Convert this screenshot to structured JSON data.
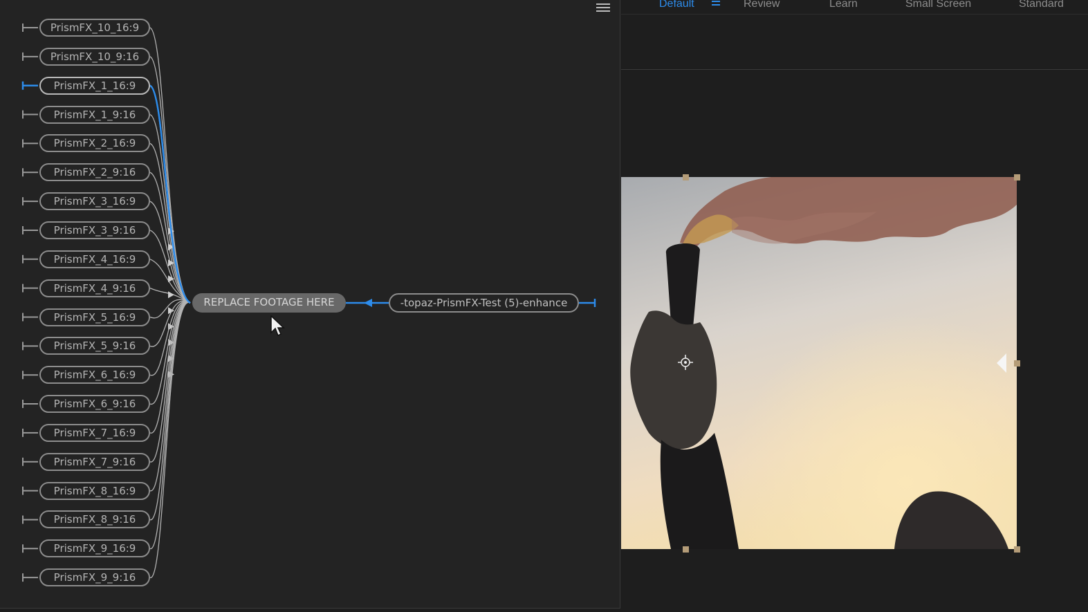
{
  "flowchart": {
    "comps": [
      "PrismFX_10_16:9",
      "PrismFX_10_9:16",
      "PrismFX_1_16:9",
      "PrismFX_1_9:16",
      "PrismFX_2_16:9",
      "PrismFX_2_9:16",
      "PrismFX_3_16:9",
      "PrismFX_3_9:16",
      "PrismFX_4_16:9",
      "PrismFX_4_9:16",
      "PrismFX_5_16:9",
      "PrismFX_5_9:16",
      "PrismFX_6_16:9",
      "PrismFX_6_9:16",
      "PrismFX_7_16:9",
      "PrismFX_7_9:16",
      "PrismFX_8_16:9",
      "PrismFX_8_9:16",
      "PrismFX_9_16:9",
      "PrismFX_9_9:16"
    ],
    "active_index": 2,
    "center_node": "REPLACE FOOTAGE HERE",
    "source_node": "-topaz-PrismFX-Test (5)-enhance",
    "colors": {
      "link": "#b3b3b3",
      "active": "#2d8ceb",
      "node_border": "#8d8d8d"
    }
  },
  "workspaces": {
    "tabs": [
      "Default",
      "Review",
      "Learn",
      "Small Screen",
      "Standard"
    ],
    "active": "Default",
    "menu_icon": "hamburger-icon"
  },
  "viewer": {
    "anchor_icon": "anchor-point-icon",
    "collapse_icon": "triangle-left-icon"
  }
}
